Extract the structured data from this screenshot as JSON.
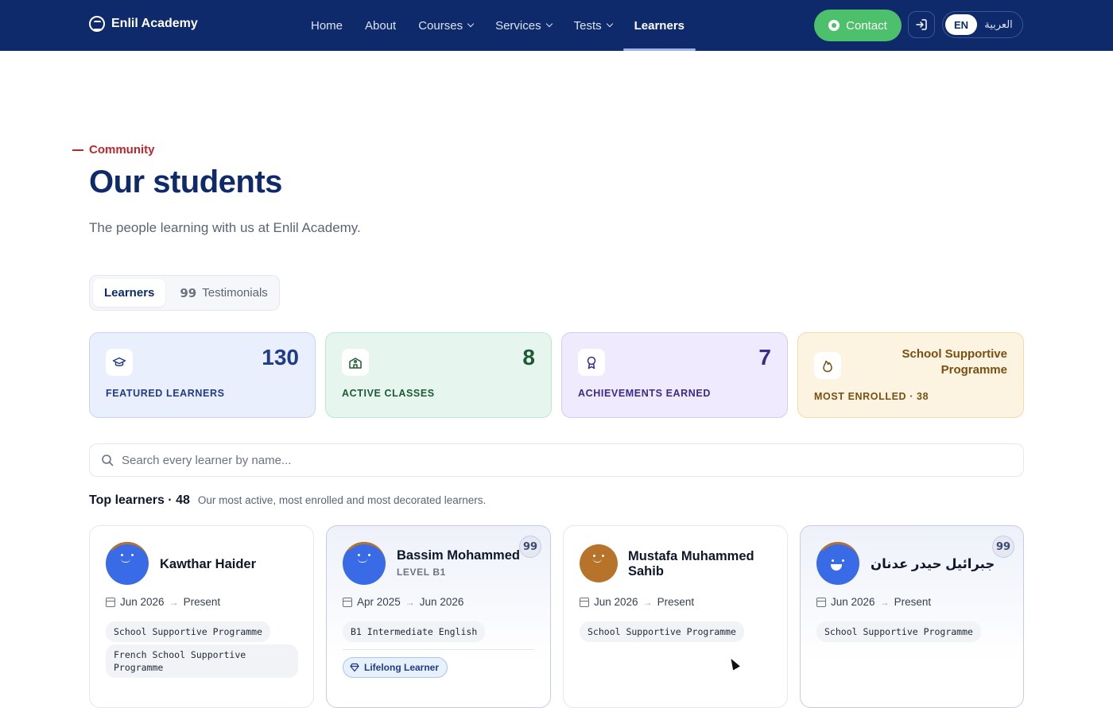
{
  "nav": {
    "brand": "Enlil Academy",
    "links": [
      {
        "label": "Home"
      },
      {
        "label": "About"
      },
      {
        "label": "Courses"
      },
      {
        "label": "Services"
      },
      {
        "label": "Tests"
      },
      {
        "label": "Learners"
      }
    ],
    "contact_label": "Contact",
    "lang_en": "EN",
    "lang_ar": "العربية"
  },
  "header": {
    "eyebrow": "Community",
    "title": "Our students",
    "subtitle": "The people learning with us at Enlil Academy."
  },
  "tabs": [
    {
      "label": "Learners",
      "active": true
    },
    {
      "label": "Testimonials",
      "active": false
    }
  ],
  "stats": [
    {
      "value": "130",
      "label": "FEATURED LEARNERS",
      "icon": "graduation-cap-icon"
    },
    {
      "value": "8",
      "label": "ACTIVE CLASSES",
      "icon": "school-icon"
    },
    {
      "value": "7",
      "label": "ACHIEVEMENTS EARNED",
      "icon": "award-icon"
    },
    {
      "value": "School Supportive Programme",
      "label": "MOST ENROLLED · 38",
      "icon": "flame-icon"
    }
  ],
  "search": {
    "placeholder": "Search every learner by name..."
  },
  "section": {
    "title": "Top learners · 48",
    "subtitle": "Our most active, most enrolled and most decorated learners."
  },
  "learners": [
    {
      "name": "Kawthar Haider",
      "level": "",
      "start": "Jun 2026",
      "end": "Present",
      "courses": [
        "School Supportive Programme",
        "French School Supportive Programme"
      ],
      "has_testimonial": false
    },
    {
      "name": "Bassim Mohammed",
      "level": "LEVEL B1",
      "start": "Apr 2025",
      "end": "Jun 2026",
      "courses": [
        "B1 Intermediate English"
      ],
      "award": "Lifelong Learner",
      "has_testimonial": true
    },
    {
      "name": "Mustafa Muhammed Sahib",
      "level": "",
      "start": "Jun 2026",
      "end": "Present",
      "courses": [
        "School Supportive Programme"
      ],
      "has_testimonial": false
    },
    {
      "name": "جبرائيل حيدر عدنان",
      "level": "",
      "start": "Jun 2026",
      "end": "Present",
      "courses": [
        "School Supportive Programme"
      ],
      "has_testimonial": true
    }
  ],
  "colors": {
    "nav_bg": "#0f2a6b",
    "accent_red": "#c0262d",
    "contact_green": "#4cc06b",
    "avatar_blue": "#3a6be6"
  }
}
